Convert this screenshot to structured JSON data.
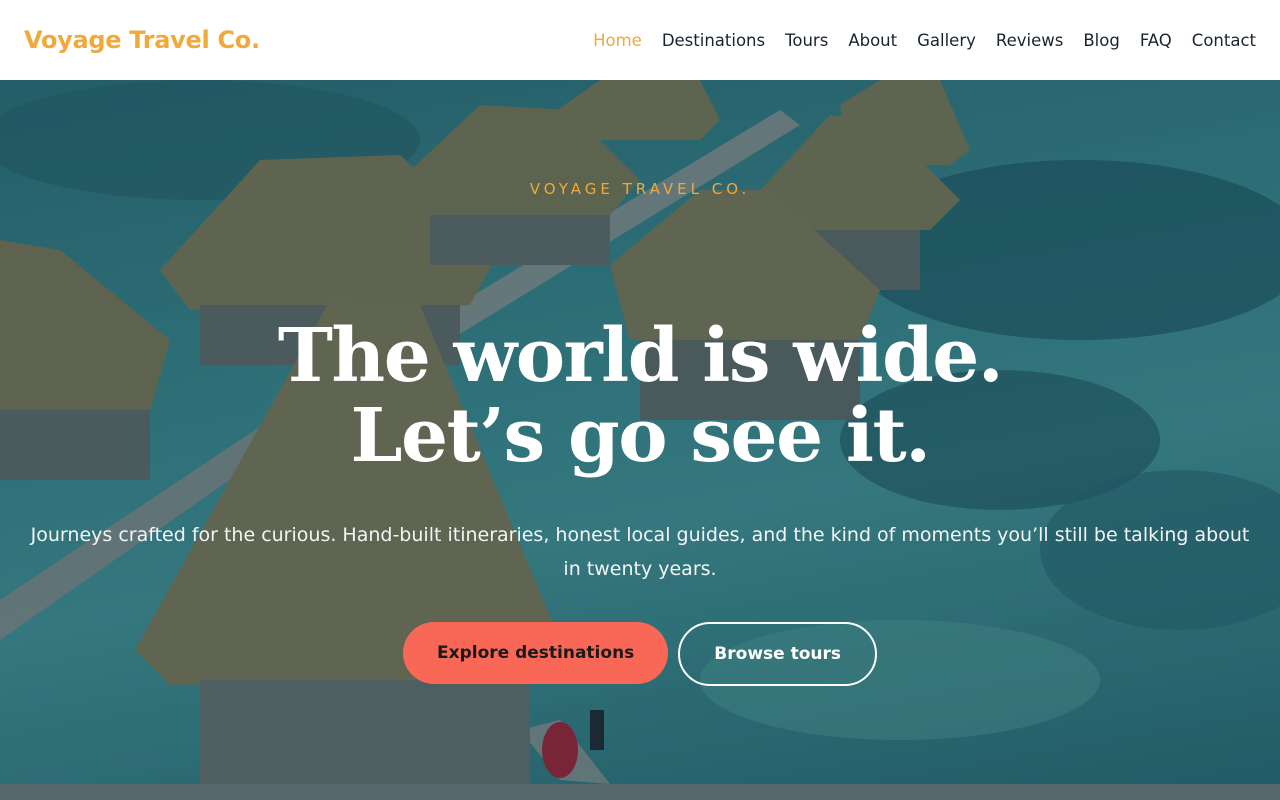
{
  "header": {
    "brand": "Voyage Travel Co.",
    "nav": [
      {
        "label": "Home",
        "active": true
      },
      {
        "label": "Destinations"
      },
      {
        "label": "Tours"
      },
      {
        "label": "About"
      },
      {
        "label": "Gallery"
      },
      {
        "label": "Reviews"
      },
      {
        "label": "Blog"
      },
      {
        "label": "FAQ"
      },
      {
        "label": "Contact"
      }
    ]
  },
  "hero": {
    "eyebrow": "VOYAGE TRAVEL CO.",
    "headline_line1": "The world is wide.",
    "headline_line2": "Let’s go see it.",
    "subtitle": "Journeys crafted for the curious. Hand-built itineraries, honest local guides, and the kind of moments you’ll still be talking about in twenty years.",
    "primary_cta": "Explore destinations",
    "secondary_cta": "Browse tours"
  },
  "colors": {
    "accent": "#f0a93b",
    "cta": "#f96756",
    "nav_text": "#1a2430"
  }
}
